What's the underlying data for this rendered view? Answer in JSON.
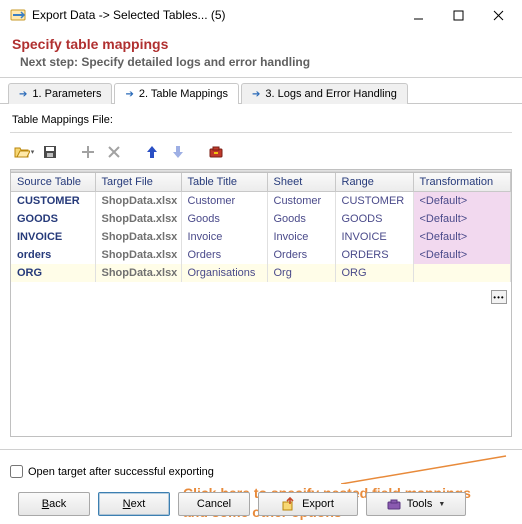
{
  "window": {
    "title": "Export Data -> Selected Tables... (5)"
  },
  "header": {
    "title": "Specify table mappings",
    "subtitle": "Next step: Specify detailed logs and error handling"
  },
  "tabs": {
    "t1": "1. Parameters",
    "t2": "2. Table Mappings",
    "t3": "3. Logs and Error Handling"
  },
  "labels": {
    "mappings_file": "Table Mappings File:"
  },
  "columns": {
    "source": "Source Table",
    "target": "Target File",
    "title": "Table Title",
    "sheet": "Sheet",
    "range": "Range",
    "trans": "Transformation"
  },
  "rows": [
    {
      "source": "CUSTOMER",
      "target": "ShopData.xlsx",
      "title": "Customer",
      "sheet": "Customer",
      "range": "CUSTOMER",
      "trans": "<Default>"
    },
    {
      "source": "GOODS",
      "target": "ShopData.xlsx",
      "title": "Goods",
      "sheet": "Goods",
      "range": "GOODS",
      "trans": "<Default>"
    },
    {
      "source": "INVOICE",
      "target": "ShopData.xlsx",
      "title": "Invoice",
      "sheet": "Invoice",
      "range": "INVOICE",
      "trans": "<Default>"
    },
    {
      "source": "orders",
      "target": "ShopData.xlsx",
      "title": "Orders",
      "sheet": "Orders",
      "range": "ORDERS",
      "trans": "<Default>"
    },
    {
      "source": "ORG",
      "target": "ShopData.xlsx",
      "title": "Organisations",
      "sheet": "Org",
      "range": "ORG",
      "trans": ""
    }
  ],
  "callout": {
    "line1": "Click here to specify nested field mappings",
    "line2": "and some other options"
  },
  "checkbox": {
    "label": "Open target after successful exporting"
  },
  "buttons": {
    "back": "Back",
    "back_u": "B",
    "next": "Next",
    "next_u": "N",
    "cancel": "Cancel",
    "export": "Export",
    "tools": "Tools"
  }
}
